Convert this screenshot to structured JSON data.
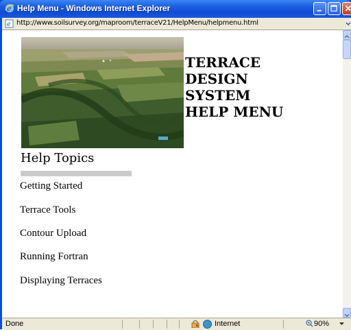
{
  "window": {
    "title": "Help Menu - Windows Internet Explorer",
    "address": "http://www.soilsurvey.org/maproom/terraceV21/HelpMenu/helpmenu.html"
  },
  "page": {
    "heading_lines": [
      "TERRACE",
      "DESIGN",
      "SYSTEM",
      "HELP MENU"
    ],
    "section_title": "Help Topics",
    "topics": [
      {
        "label": "Getting Started"
      },
      {
        "label": "Terrace Tools"
      },
      {
        "label": "Contour Upload"
      },
      {
        "label": "Running Fortran"
      },
      {
        "label": "Displaying Terraces"
      }
    ]
  },
  "status": {
    "text": "Done",
    "zone": "Internet",
    "zoom": "90%"
  },
  "icons": [
    "ie-icon",
    "minimize-icon",
    "maximize-icon",
    "close-icon",
    "page-icon",
    "lock-icon",
    "globe-icon",
    "zoom-icon"
  ],
  "colors": {
    "titlebar": "#0f4bd6",
    "close_button": "#c6391d",
    "chrome": "#ece9d8",
    "divider_bar": "#cbcbcb"
  }
}
